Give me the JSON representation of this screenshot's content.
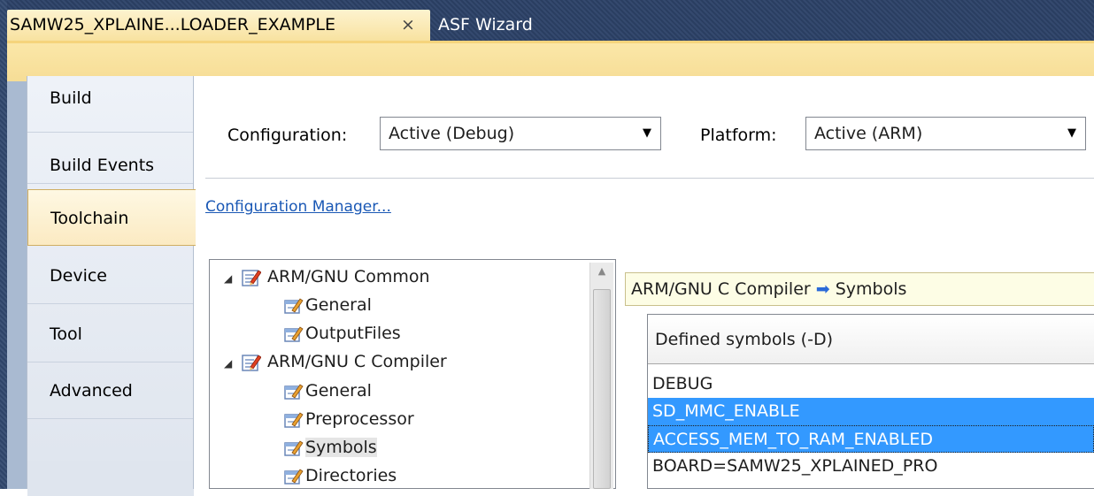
{
  "tabs": {
    "active_title": "SAMW25_XPLAINE...LOADER_EXAMPLE",
    "close_glyph": "×",
    "other_title": "ASF Wizard"
  },
  "sidebar": {
    "items": [
      {
        "label": "Build",
        "selected": false
      },
      {
        "label": "Build Events",
        "selected": false
      },
      {
        "label": "Toolchain",
        "selected": true
      },
      {
        "label": "Device",
        "selected": false
      },
      {
        "label": "Tool",
        "selected": false
      },
      {
        "label": "Advanced",
        "selected": false
      }
    ]
  },
  "config": {
    "configuration_label": "Configuration:",
    "configuration_value": "Active (Debug)",
    "platform_label": "Platform:",
    "platform_value": "Active (ARM)",
    "manager_link": "Configuration Manager..."
  },
  "tree": {
    "groups": [
      {
        "label": "ARM/GNU Common",
        "expanded": true,
        "children": [
          "General",
          "OutputFiles"
        ]
      },
      {
        "label": "ARM/GNU C Compiler",
        "expanded": true,
        "children": [
          "General",
          "Preprocessor",
          "Symbols",
          "Directories"
        ]
      }
    ],
    "selected": "Symbols"
  },
  "breadcrumb": {
    "section": "ARM/GNU C Compiler",
    "arrow": "➡",
    "page": "Symbols"
  },
  "symbols": {
    "header": "Defined symbols (-D)",
    "items": [
      {
        "value": "DEBUG",
        "selected": false
      },
      {
        "value": "SD_MMC_ENABLE",
        "selected": true
      },
      {
        "value": "ACCESS_MEM_TO_RAM_ENABLED",
        "selected": true
      },
      {
        "value": "BOARD=SAMW25_XPLAINED_PRO",
        "selected": false
      }
    ]
  },
  "colors": {
    "tab_strip": "#2e4468",
    "active_tab": "#f8e2a0",
    "selection": "#3399ff",
    "link": "#1a58b5"
  }
}
